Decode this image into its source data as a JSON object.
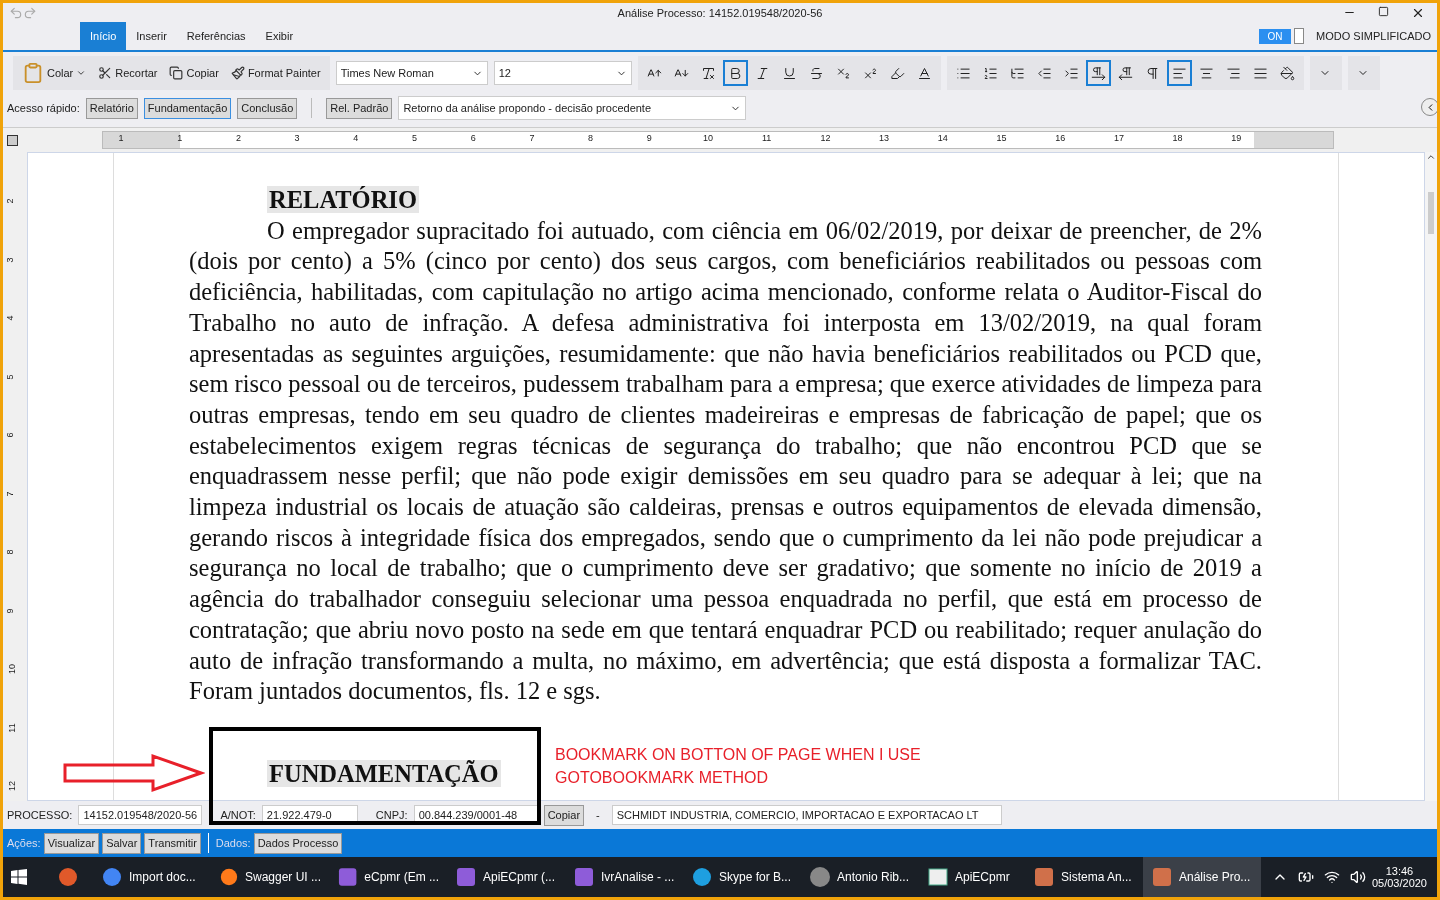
{
  "window": {
    "title": "Análise Processo: 14152.019548/2020-56"
  },
  "tabs": [
    {
      "label": "Início",
      "selected": true
    },
    {
      "label": "Inserir",
      "selected": false
    },
    {
      "label": "Referências",
      "selected": false
    },
    {
      "label": "Exibir",
      "selected": false
    }
  ],
  "mode_toggle": {
    "label": "ON",
    "on": true,
    "caption": "MODO SIMPLIFICADO"
  },
  "clipboard": [
    {
      "label": "Colar",
      "kind": "paste"
    },
    {
      "label": "Recortar",
      "kind": "cut"
    },
    {
      "label": "Copiar",
      "kind": "copy"
    },
    {
      "label": "Format Painter",
      "kind": "painter"
    }
  ],
  "font": {
    "family": "Times New Roman",
    "size": "12"
  },
  "format_buttons": [
    {
      "selected": false
    },
    {
      "selected": false
    },
    {
      "selected": false
    },
    {
      "selected": true
    },
    {
      "selected": false
    },
    {
      "selected": false
    },
    {
      "selected": false
    },
    {
      "selected": false
    },
    {
      "selected": false
    },
    {
      "selected": false
    },
    {
      "selected": false
    }
  ],
  "paragraph_buttons": [
    {
      "selected": false
    },
    {
      "selected": false
    },
    {
      "selected": false
    },
    {
      "selected": false
    },
    {
      "selected": false
    },
    {
      "selected": true
    },
    {
      "selected": false
    },
    {
      "selected": false
    },
    {
      "selected": true
    },
    {
      "selected": false
    },
    {
      "selected": false
    },
    {
      "selected": false
    },
    {
      "selected": false
    }
  ],
  "quick_access": {
    "label": "Acesso rápido:",
    "buttons": [
      {
        "label": "Relatório",
        "selected": false
      },
      {
        "label": "Fundamentação",
        "selected": true
      },
      {
        "label": "Conclusão",
        "selected": false
      }
    ],
    "template_button": "Rel. Padrão",
    "template": "Retorno da análise propondo - decisão procedente"
  },
  "ruler": {
    "labels": [
      "1",
      "1",
      "2",
      "3",
      "4",
      "5",
      "6",
      "7",
      "8",
      "9",
      "10",
      "11",
      "12",
      "13",
      "14",
      "15",
      "16",
      "17",
      "18",
      "19"
    ]
  },
  "vertical_ruler": {
    "labels": [
      "2",
      "3",
      "4",
      "5",
      "6",
      "7",
      "8",
      "9",
      "10",
      "11",
      "12"
    ]
  },
  "document": {
    "heading": "RELATÓRIO",
    "paragraph": "O empregador supracitado foi autuado, com ciência em 06/02/2019, por deixar de preencher, de 2% (dois por cento) a 5% (cinco por cento) dos seus cargos, com beneficiários reabilitados ou pessoas com deficiência, habilitadas, com capitulação no artigo acima mencionado, conforme relata o Auditor-Fiscal do Trabalho no auto de infração. A defesa administrativa foi interposta em 13/02/2019, na qual foram apresentadas as seguintes arguições, resumidamente: que não havia beneficiários reabilitados ou PCD que, sem risco pessoal ou de terceiros, pudessem trabalham para a empresa;  que exerce atividades de limpeza para outras empresas, tendo em seu quadro de clientes madeireiras e empresas de fabricação de papel; que os estabelecimentos exigem regras técnicas de segurança do trabalho; que não encontrou PCD que se enquadrassem nesse perfil; que não pode exigir demissões em seu quadro para se adequar à lei; que na limpeza industrial os locais de atuação são caldeiras, prensas e outros equipamentos de elevada dimensão, gerando riscos à integridade física dos empregados, sendo que o cumprimento da lei não pode prejudicar a segurança no local de trabalho; que o cumprimento deve ser gradativo; que somente no início de 2019 a agência do trabalhador conseguiu selecionar uma pessoa enquadrada no perfil, que está em processo de contratação; que abriu novo posto na sede em que tentará enquadrar PCD ou reabilitado; requer anulação do auto de infração transformando a multa, no máximo, em advertência; que está disposta a formalizar TAC. Foram juntados documentos, fls. 12 e sgs.",
    "heading_2": "FUNDAMENTAÇÃO"
  },
  "annotation": {
    "lines": [
      "BOOKMARK ON BOTTON OF PAGE WHEN I USE",
      "GOTOBOOKMARK METHOD"
    ]
  },
  "status_fields": [
    {
      "label": "PROCESSO:",
      "value": "14152.019548/2020-56"
    },
    {
      "label": "A/NOT:",
      "value": "21.922.479-0"
    },
    {
      "label": "CNPJ:",
      "value": "00.844.239/0001-48"
    }
  ],
  "copy_button": "Copiar",
  "separator": "-",
  "company": "SCHMIDT INDUSTRIA, COMERCIO, IMPORTACAO E EXPORTACAO LT",
  "actions": {
    "label": "Ações:",
    "buttons": [
      "Visualizar",
      "Salvar",
      "Transmitir"
    ],
    "data_label": "Dados:",
    "data_button": "Dados Processo"
  },
  "taskbar": {
    "items": [
      {
        "selected": false
      },
      {
        "label": "Import doc...",
        "selected": false
      },
      {
        "label": "Swagger UI ...",
        "selected": false
      },
      {
        "label": "eCpmr (Em ...",
        "selected": false
      },
      {
        "label": "ApiECpmr (...",
        "selected": false
      },
      {
        "label": "IvrAnalise - ...",
        "selected": false
      },
      {
        "label": "Skype for B...",
        "selected": false
      },
      {
        "label": "Antonio Rib...",
        "selected": false
      },
      {
        "label": "ApiECpmr",
        "selected": false
      },
      {
        "label": "Sistema An...",
        "selected": false
      },
      {
        "label": "Análise Pro...",
        "selected": true
      }
    ],
    "time": "13:46",
    "date": "05/03/2020"
  }
}
